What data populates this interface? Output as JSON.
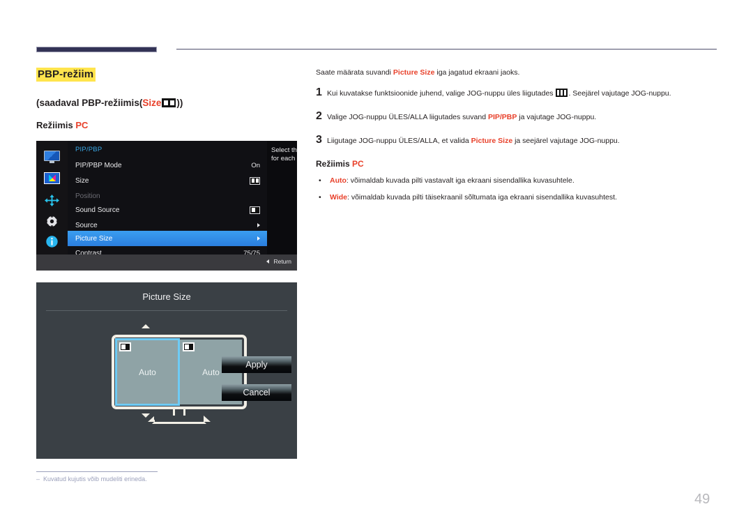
{
  "header": {
    "section_title": "PBP-režiim",
    "availability_prefix": "(saadaval PBP-režiimis(",
    "availability_size_label": "Size",
    "availability_suffix": "))",
    "size_icon": "two-pane-icon",
    "mode_label": "Režiimis ",
    "mode_value": "PC"
  },
  "osd_menu": {
    "title": "PIP/PBP",
    "rail_icons": [
      "monitor-icon",
      "pip-pbp-icon",
      "position-arrows-icon",
      "gear-icon",
      "info-icon"
    ],
    "rows": [
      {
        "label": "PIP/PBP Mode",
        "value": "On",
        "type": "text",
        "state": "normal"
      },
      {
        "label": "Size",
        "value": "",
        "type": "icon-two-pane",
        "state": "normal"
      },
      {
        "label": "Position",
        "value": "",
        "type": "none",
        "state": "disabled"
      },
      {
        "label": "Sound Source",
        "value": "",
        "type": "icon-one-pane",
        "state": "normal"
      },
      {
        "label": "Source",
        "value": "",
        "type": "arrow",
        "state": "normal"
      },
      {
        "label": "Picture Size",
        "value": "",
        "type": "arrow",
        "state": "selected"
      },
      {
        "label": "Contrast",
        "value": "75/75",
        "type": "text",
        "state": "normal"
      }
    ],
    "info_text": "Select the source for each screen.",
    "return_label": "Return"
  },
  "picture_size_dialog": {
    "title": "Picture Size",
    "left_pane_label": "Auto",
    "right_pane_label": "Auto",
    "selected_pane": "left",
    "apply_label": "Apply",
    "cancel_label": "Cancel",
    "accent_color": "#6ecbf5",
    "panel_color": "#3a4045"
  },
  "footnote": {
    "dash": "‒",
    "text": "Kuvatud kujutis võib mudeliti erineda."
  },
  "instructions": {
    "lead_part1": "Saate määrata suvandi ",
    "lead_highlight": "Picture Size",
    "lead_part2": " iga jagatud ekraani jaoks.",
    "steps": [
      {
        "number": "1",
        "part1": "Kui kuvatakse funktsioonide juhend, valige JOG-nuppu üles liigutades ",
        "icon": "osd-three-bars-icon",
        "part2": ". Seejärel vajutage JOG-nuppu."
      },
      {
        "number": "2",
        "part1": "Valige JOG-nuppu ÜLES/ALLA liigutades suvand ",
        "highlight": "PIP/PBP",
        "part2": " ja vajutage JOG-nuppu."
      },
      {
        "number": "3",
        "part1": "Liigutage JOG-nuppu ÜLES/ALLA, et valida ",
        "highlight": "Picture Size",
        "part2": " ja seejärel vajutage JOG-nuppu."
      }
    ],
    "mode_label": "Režiimis ",
    "mode_value": "PC",
    "bullets": [
      {
        "dot": "•",
        "term": "Auto",
        "text": ": võimaldab kuvada pilti vastavalt iga ekraani sisendallika kuvasuhtele."
      },
      {
        "dot": "•",
        "term": "Wide",
        "text": ": võimaldab kuvada pilti täisekraanil sõltumata iga ekraani sisendallika kuvasuhtest."
      }
    ]
  },
  "page_number": "49"
}
